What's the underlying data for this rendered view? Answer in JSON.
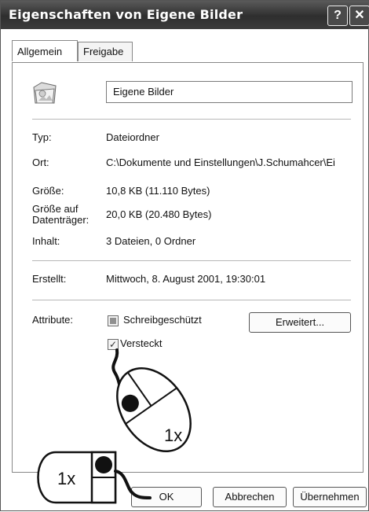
{
  "window": {
    "title": "Eigenschaften von Eigene Bilder",
    "help_glyph": "?",
    "close_glyph": "✕"
  },
  "tabs": [
    {
      "label": "Allgemein",
      "active": true
    },
    {
      "label": "Freigabe",
      "active": false
    }
  ],
  "general": {
    "folder_icon": "folder-pictures-icon",
    "name_value": "Eigene Bilder",
    "fields": {
      "type_label": "Typ:",
      "type_value": "Dateiordner",
      "location_label": "Ort:",
      "location_value": "C:\\Dokumente und Einstellungen\\J.Schumahcer\\Ei",
      "size_label": "Größe:",
      "size_value": "10,8 KB (11.110 Bytes)",
      "disk_size_label_1": "Größe auf",
      "disk_size_label_2": "Datenträger:",
      "disk_size_value": "20,0 KB (20.480 Bytes)",
      "contents_label": "Inhalt:",
      "contents_value": "3 Dateien, 0 Ordner",
      "created_label": "Erstellt:",
      "created_value": "Mittwoch, 8. August 2001, 19:30:01"
    },
    "attributes": {
      "label": "Attribute:",
      "readonly_label": "Schreibgeschützt",
      "readonly_checked": false,
      "hidden_label": "Versteckt",
      "hidden_checked": true,
      "advanced_button": "Erweitert..."
    }
  },
  "annotations": {
    "click_count_1": "1x",
    "click_count_2": "1x"
  },
  "footer": {
    "ok": "OK",
    "cancel": "Abbrechen",
    "apply": "Übernehmen"
  }
}
